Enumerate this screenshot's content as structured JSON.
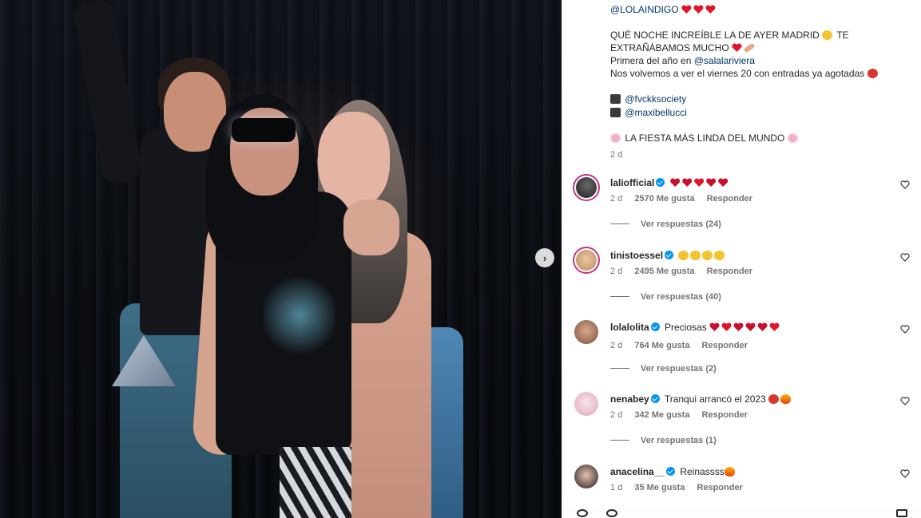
{
  "post": {
    "caption_lines": [
      {
        "mention": "@LOLAINDIGO"
      },
      {
        "text": "QUÉ NOCHE INCREÍBLE LA DE AYER MADRID",
        "text2": "TE"
      },
      {
        "text": "EXTRAÑÁBAMOS MUCHO"
      },
      {
        "text": "Primera del año en",
        "mention": "@salalariviera"
      },
      {
        "text": "Nos volvemos a ver el viernes 20 con entradas ya agotadas"
      },
      {
        "mention": "@fvckksociety"
      },
      {
        "mention": "@maxibellucci"
      },
      {
        "text": "LA FIESTA MÁS LINDA DEL MUNDO"
      }
    ],
    "time": "2 d"
  },
  "comments": [
    {
      "username": "laliofficial",
      "text": "",
      "time": "2 d",
      "likes": "2570 Me gusta",
      "reply": "Responder",
      "replies": "Ver respuestas (24)",
      "ring": true
    },
    {
      "username": "tinistoessel",
      "text": "",
      "time": "2 d",
      "likes": "2495 Me gusta",
      "reply": "Responder",
      "replies": "Ver respuestas (40)",
      "ring": true
    },
    {
      "username": "lolalolita",
      "text": "Preciosas",
      "time": "2 d",
      "likes": "764 Me gusta",
      "reply": "Responder",
      "replies": "Ver respuestas (2)",
      "ring": false
    },
    {
      "username": "nenabey",
      "text": "Tranqui arrancó el 2023",
      "time": "2 d",
      "likes": "342 Me gusta",
      "reply": "Responder",
      "replies": "Ver respuestas (1)",
      "ring": false
    },
    {
      "username": "anacelina__",
      "text": "Reinassss",
      "time": "1 d",
      "likes": "35 Me gusta",
      "reply": "Responder",
      "replies": "",
      "ring": false
    }
  ],
  "icons": {
    "next": "chevron-right-icon",
    "like": "heart-outline-icon",
    "verified": "verified-badge-icon"
  },
  "colors": {
    "link": "#00376b",
    "verified": "#0095f6",
    "secondary_text": "#737373",
    "story_ring": "#c13584"
  }
}
